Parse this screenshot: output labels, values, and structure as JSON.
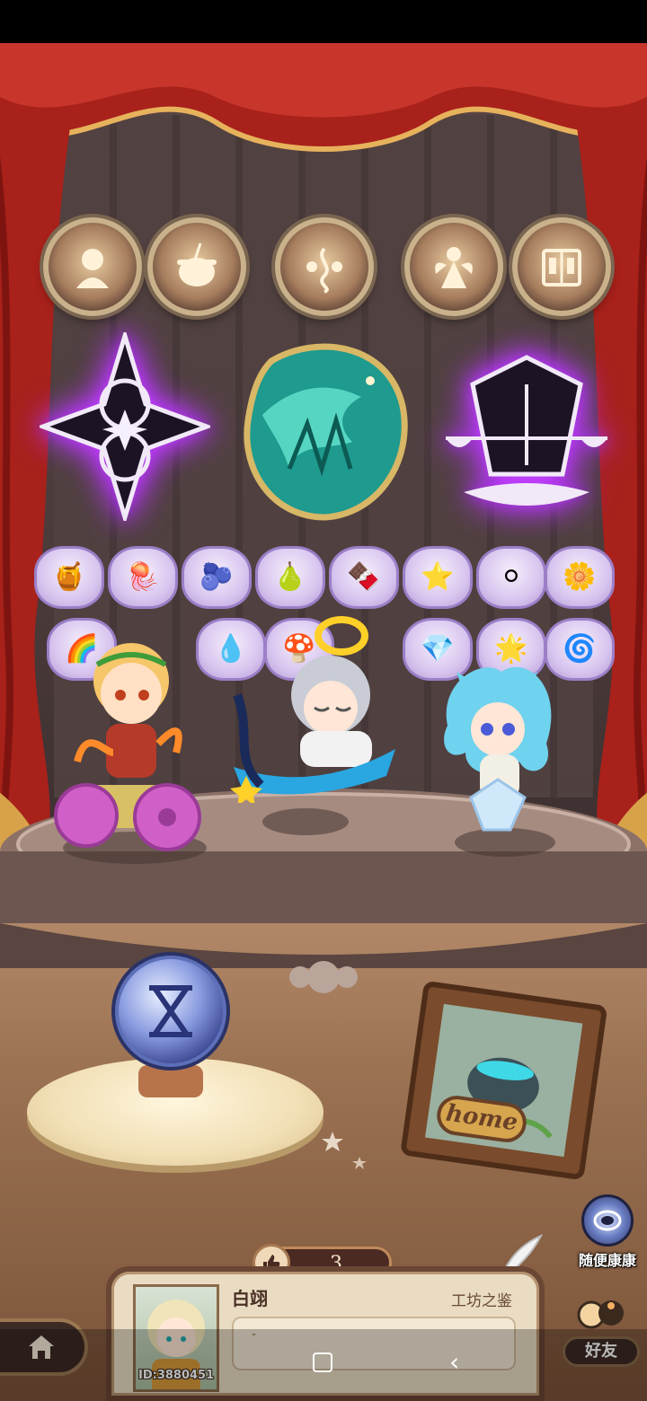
{
  "status_bar": {},
  "medals": [
    {
      "icon": "silhouette-icon"
    },
    {
      "icon": "cauldron-icon"
    },
    {
      "icon": "ornament-icon"
    },
    {
      "icon": "fairy-icon"
    },
    {
      "icon": "book-icon"
    }
  ],
  "badges": [
    {
      "icon": "compass-star-badge",
      "glow": "purple"
    },
    {
      "icon": "dragon-badge",
      "glow": "none"
    },
    {
      "icon": "lantern-scales-badge",
      "glow": "purple"
    }
  ],
  "materials_row1": [
    "🍯",
    "🪼",
    "🫐",
    "🍐",
    "🍫",
    "⭐",
    "⚪",
    "🌼"
  ],
  "materials_row2": [
    "🌈",
    "",
    "💧",
    "🍄",
    "",
    "💎",
    "🌟",
    "🌀"
  ],
  "orb": {
    "icon": "hourglass-icon"
  },
  "frame": {
    "label": "home"
  },
  "random_visit": {
    "label": "随便康康"
  },
  "likes": {
    "count": "3"
  },
  "profile": {
    "username": "白翊",
    "title": "工坊之鉴",
    "id": "ID:3880451",
    "message": "-"
  },
  "friends": {
    "label": "好友"
  },
  "colors": {
    "accent_purple": "#c847ff",
    "curtain_red": "#b3241c",
    "wood": "#6a4634"
  }
}
